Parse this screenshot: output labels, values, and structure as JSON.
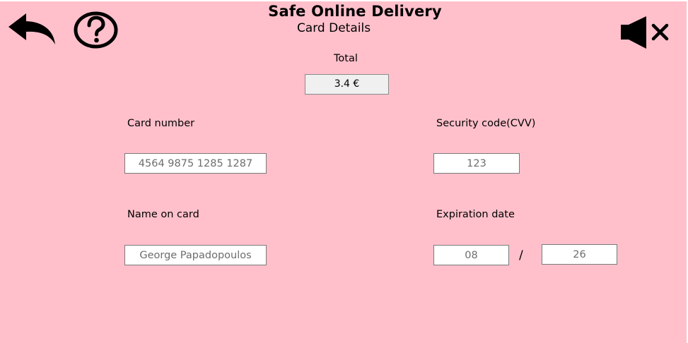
{
  "header": {
    "title": "Safe Online Delivery",
    "subtitle": "Card Details"
  },
  "icons": {
    "back": "back-arrow-icon",
    "help": "help-icon",
    "mute": "speaker-mute-icon"
  },
  "total": {
    "label": "Total",
    "value": "3.4 €"
  },
  "card_number": {
    "label": "Card number",
    "value": "4564 9875 1285 1287"
  },
  "cvv": {
    "label": "Security code(CVV)",
    "value": "123"
  },
  "name_on_card": {
    "label": "Name on card",
    "value": "George Papadopoulos"
  },
  "expiration": {
    "label": "Expiration date",
    "month": "08",
    "separator": "/",
    "year": "26"
  },
  "colors": {
    "background": "#ffc0cb",
    "field_border": "#7a7a7a",
    "field_text": "#6d6d6d"
  }
}
